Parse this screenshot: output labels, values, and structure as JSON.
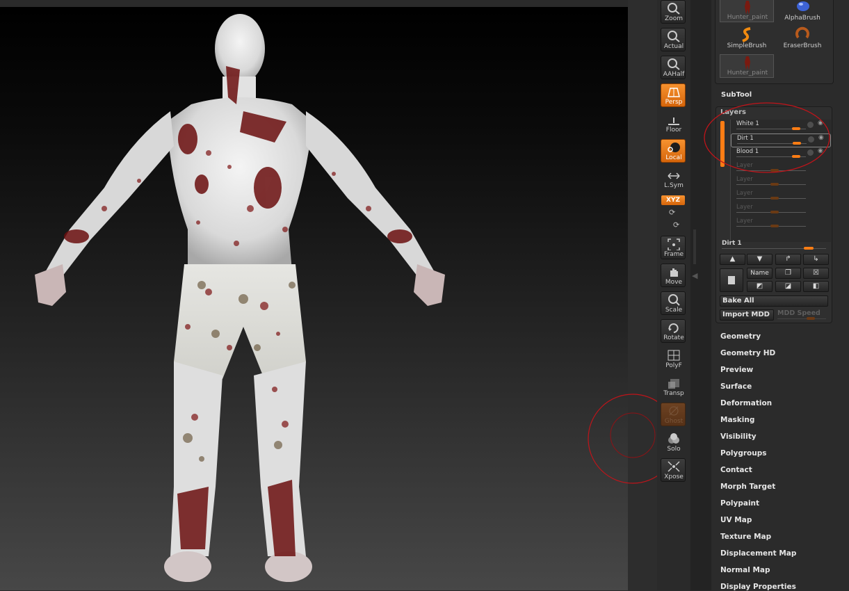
{
  "toolbar": {
    "buttons": [
      {
        "label": "Zoom",
        "icon": "zoom-icon",
        "state": "normal"
      },
      {
        "label": "Actual",
        "icon": "actual-icon",
        "state": "normal"
      },
      {
        "label": "AAHalf",
        "icon": "aahalf-icon",
        "state": "normal"
      },
      {
        "label": "Persp",
        "icon": "perspective-grid-icon",
        "state": "active"
      },
      {
        "label": "Floor",
        "icon": "floor-icon",
        "state": "plain"
      },
      {
        "label": "Local",
        "icon": "local-icon",
        "state": "active"
      },
      {
        "label": "L.Sym",
        "icon": "local-symmetry-icon",
        "state": "plain"
      },
      {
        "label": "Frame",
        "icon": "frame-icon",
        "state": "normal"
      },
      {
        "label": "Move",
        "icon": "move-hand-icon",
        "state": "normal"
      },
      {
        "label": "Scale",
        "icon": "scale-icon",
        "state": "normal"
      },
      {
        "label": "Rotate",
        "icon": "rotate-icon",
        "state": "normal"
      },
      {
        "label": "PolyF",
        "icon": "polyframe-icon",
        "state": "plain"
      },
      {
        "label": "Transp",
        "icon": "transparency-icon",
        "state": "plain"
      },
      {
        "label": "Ghost",
        "icon": "ghost-icon",
        "state": "ghost"
      },
      {
        "label": "Solo",
        "icon": "solo-icon",
        "state": "plain"
      },
      {
        "label": "Xpose",
        "icon": "xpose-icon",
        "state": "normal"
      }
    ],
    "xyz_label": "XYZ",
    "active_color": "#f07f1a"
  },
  "brushes": [
    {
      "label": "Hunter_paint",
      "icon": "hunter-figure-icon"
    },
    {
      "label": "AlphaBrush",
      "icon": "alpha-brush-icon"
    },
    {
      "label": "SimpleBrush",
      "icon": "simple-brush-icon"
    },
    {
      "label": "EraserBrush",
      "icon": "eraser-brush-icon"
    },
    {
      "label": "Hunter_paint",
      "icon": "hunter-figure-icon"
    }
  ],
  "subtool_label": "SubTool",
  "layers": {
    "title": "Layers",
    "items": [
      {
        "name": "White 1",
        "active": true,
        "selected": false,
        "intensity": 0.86
      },
      {
        "name": "Dirt 1",
        "active": true,
        "selected": true,
        "intensity": 0.86
      },
      {
        "name": "Blood 1",
        "active": true,
        "selected": false,
        "intensity": 0.86
      },
      {
        "name": "Layer",
        "active": false,
        "selected": false,
        "intensity": 0.55
      },
      {
        "name": "Layer",
        "active": false,
        "selected": false,
        "intensity": 0.55
      },
      {
        "name": "Layer",
        "active": false,
        "selected": false,
        "intensity": 0.55
      },
      {
        "name": "Layer",
        "active": false,
        "selected": false,
        "intensity": 0.55
      },
      {
        "name": "Layer",
        "active": false,
        "selected": false,
        "intensity": 0.55
      }
    ],
    "current_layer": "Dirt 1",
    "name_button": "Name",
    "bake_all": "Bake All",
    "import_mdd": "Import MDD",
    "mdd_speed": "MDD Speed"
  },
  "menu_items": [
    "Geometry",
    "Geometry HD",
    "Preview",
    "Surface",
    "Deformation",
    "Masking",
    "Visibility",
    "Polygroups",
    "Contact",
    "Morph Target",
    "Polypaint",
    "UV Map",
    "Texture Map",
    "Displacement Map",
    "Normal Map",
    "Display Properties"
  ],
  "annotation_color": "#c0141a"
}
